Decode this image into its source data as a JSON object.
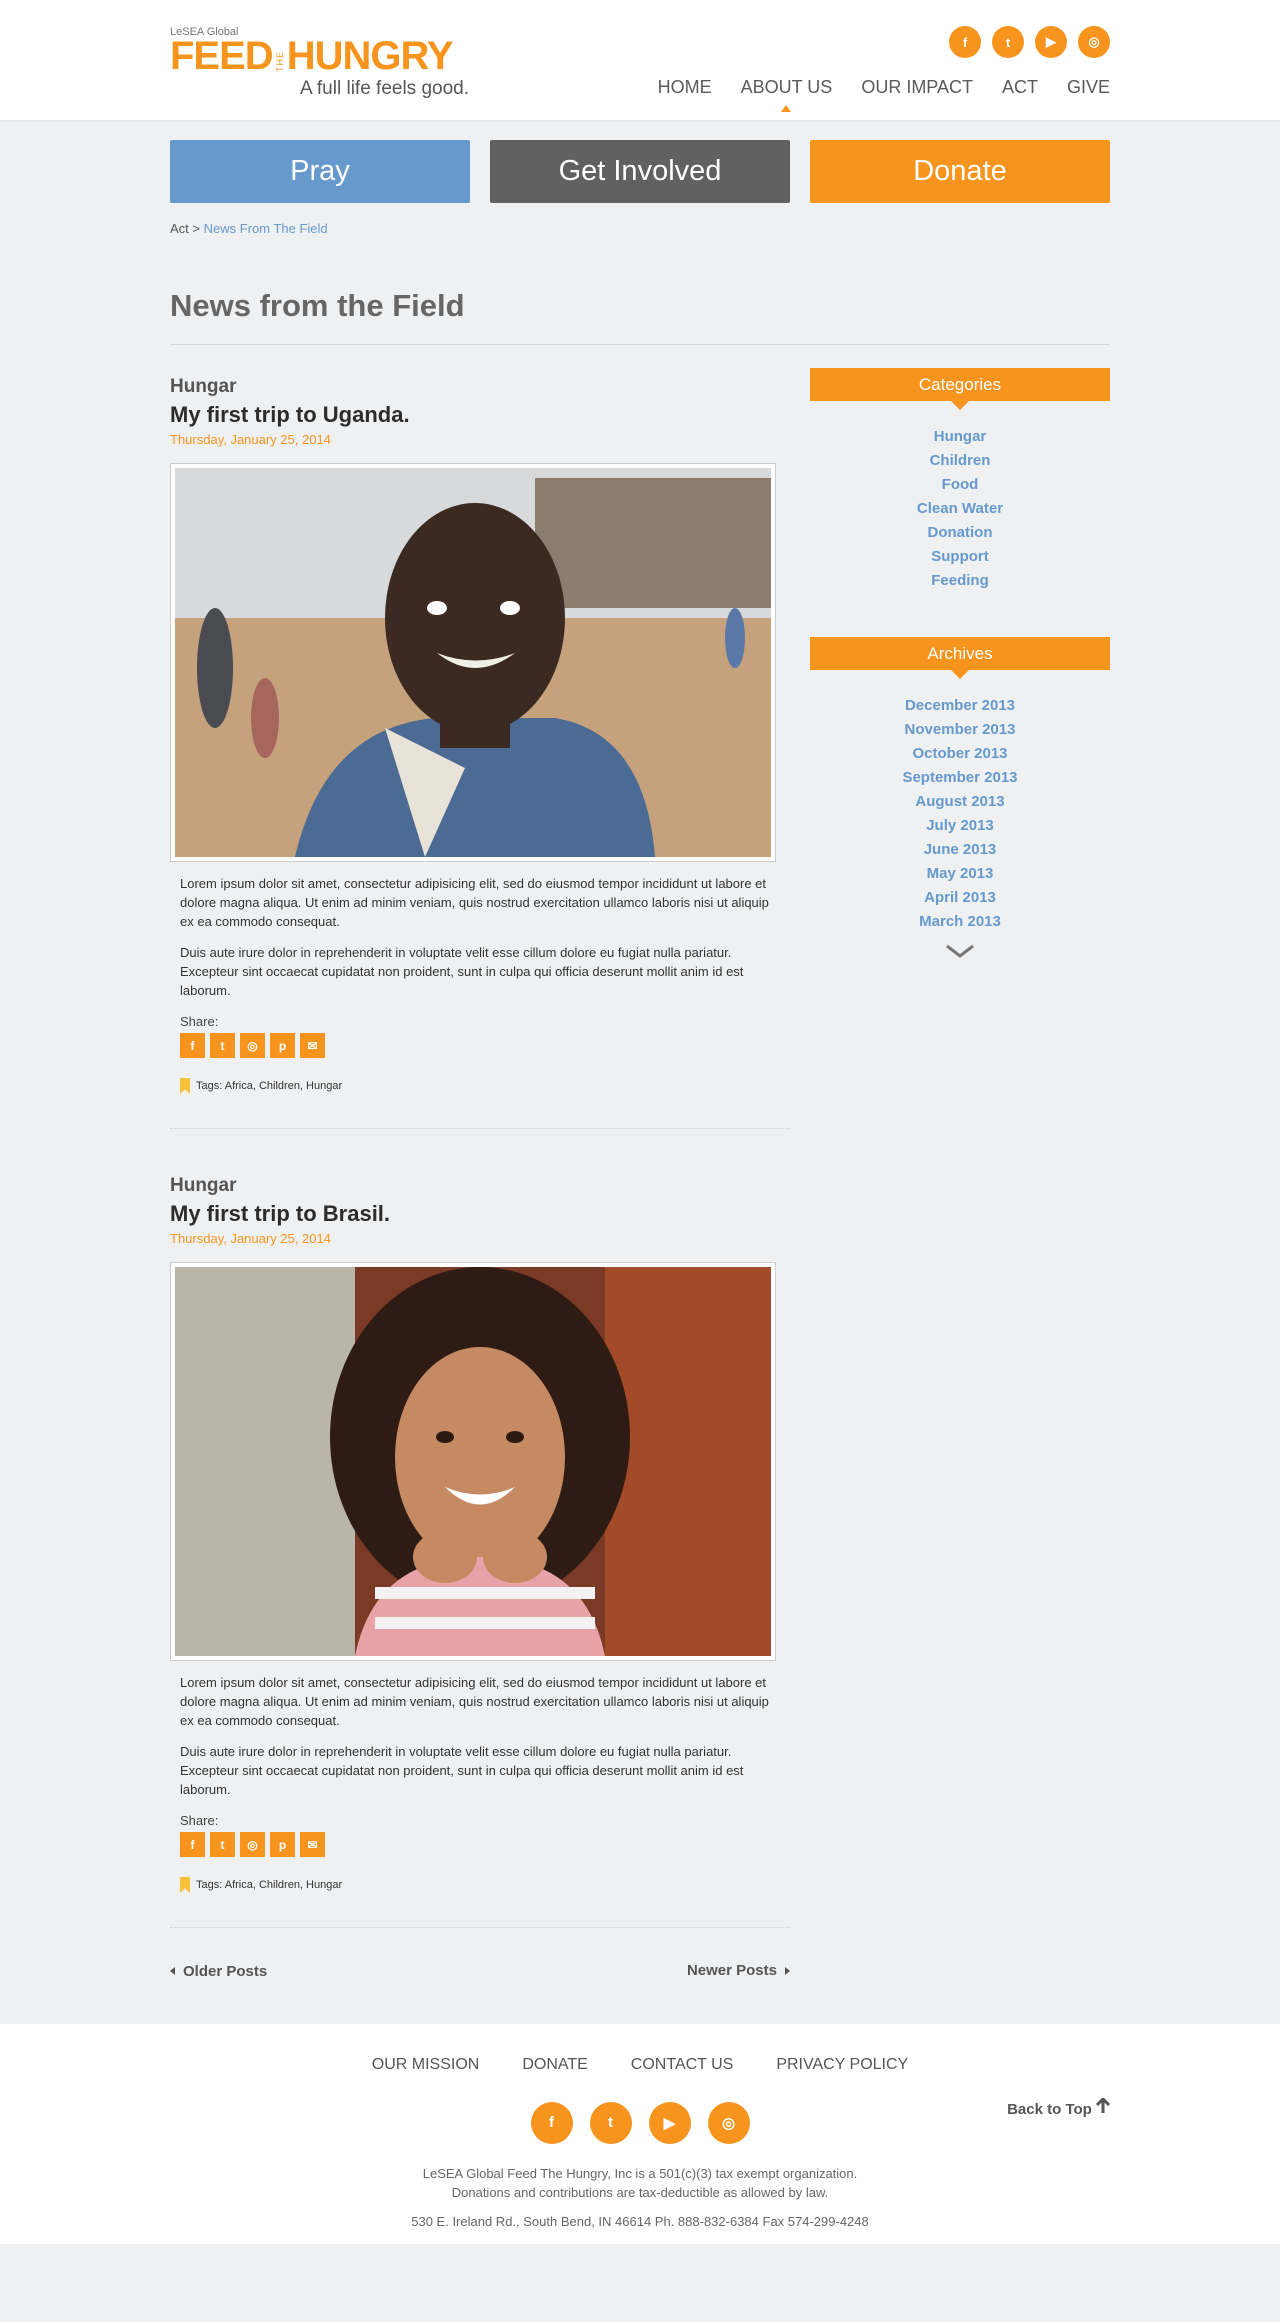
{
  "brand": {
    "small": "LeSEA Global",
    "feed": "FEED",
    "the": "THE",
    "hungry": "HUNGRY",
    "tagline": "A full life feels good.",
    "accent": "#f7941d",
    "blue": "#6699cc"
  },
  "social_icons": [
    "facebook-icon",
    "twitter-icon",
    "youtube-icon",
    "instagram-icon"
  ],
  "nav": [
    "HOME",
    "ABOUT US",
    "OUR IMPACT",
    "ACT",
    "GIVE"
  ],
  "cta": {
    "pray": "Pray",
    "involved": "Get Involved",
    "donate": "Donate"
  },
  "breadcrumb": {
    "parent": "Act",
    "sep": ">",
    "current": "News From The Field"
  },
  "page_title": "News from the Field",
  "posts": [
    {
      "category": "Hungar",
      "title": "My first trip to Uganda.",
      "date": "Thursday, January 25, 2014",
      "p1": "Lorem ipsum dolor sit amet, consectetur adipisicing elit, sed do eiusmod tempor incididunt ut labore et dolore magna aliqua. Ut enim ad minim veniam, quis nostrud exercitation ullamco laboris nisi ut aliquip ex ea commodo consequat.",
      "p2": "Duis aute irure dolor in reprehenderit in voluptate velit esse cillum dolore eu fugiat nulla pariatur. Excepteur sint occaecat cupidatat non proident, sunt in culpa qui officia deserunt mollit anim id est laborum.",
      "share": "Share:",
      "tags": "Tags: Africa, Children, Hungar"
    },
    {
      "category": "Hungar",
      "title": "My first trip to Brasil.",
      "date": "Thursday, January 25, 2014",
      "p1": "Lorem ipsum dolor sit amet, consectetur adipisicing elit, sed do eiusmod tempor incididunt ut labore et dolore magna aliqua. Ut enim ad minim veniam, quis nostrud exercitation ullamco laboris nisi ut aliquip ex ea commodo consequat.",
      "p2": "Duis aute irure dolor in reprehenderit in voluptate velit esse cillum dolore eu fugiat nulla pariatur. Excepteur sint occaecat cupidatat non proident, sunt in culpa qui officia deserunt mollit anim id est laborum.",
      "share": "Share:",
      "tags": "Tags: Africa, Children, Hungar"
    }
  ],
  "pager": {
    "older": "Older Posts",
    "newer": "Newer Posts",
    "top": "Back to Top"
  },
  "sidebar": {
    "categories_title": "Categories",
    "categories": [
      "Hungar",
      "Children",
      "Food",
      "Clean Water",
      "Donation",
      "Support",
      "Feeding"
    ],
    "archives_title": "Archives",
    "archives": [
      "December 2013",
      "November 2013",
      "October 2013",
      "September 2013",
      "August 2013",
      "July 2013",
      "June 2013",
      "May 2013",
      "April 2013",
      "March 2013"
    ]
  },
  "footer": {
    "nav": [
      "OUR MISSION",
      "DONATE",
      "CONTACT US",
      "PRIVACY POLICY"
    ],
    "line1": "LeSEA Global Feed The Hungry, Inc is a 501(c)(3) tax exempt organization.",
    "line2": "Donations and contributions are tax-deductible as allowed by law.",
    "address": "530 E. Ireland Rd., South Bend, IN 46614   Ph. 888-832-6384   Fax 574-299-4248"
  }
}
